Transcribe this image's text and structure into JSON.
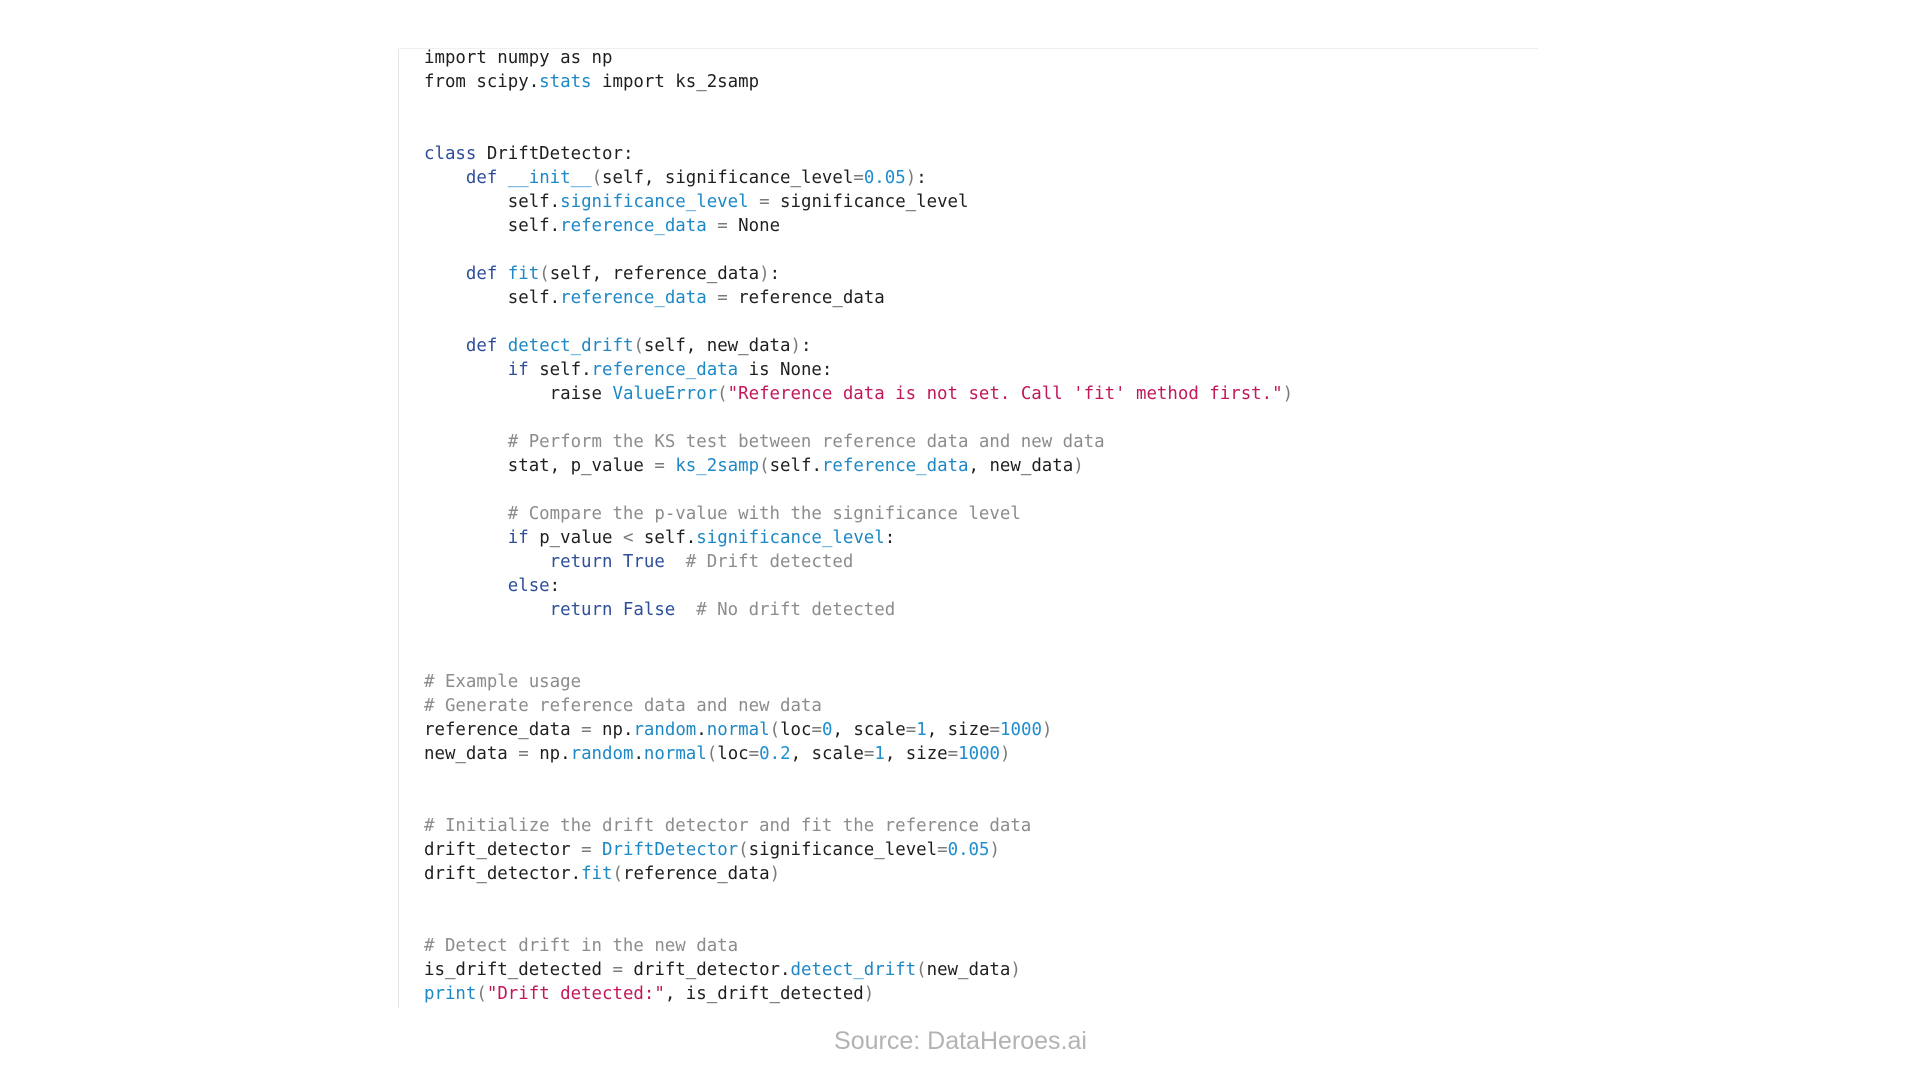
{
  "colors": {
    "keyword": "#2d4f9a",
    "attribute": "#1d88c6",
    "number": "#1f8ecf",
    "string": "#c2185b",
    "comment": "#8c8c8c",
    "punctuation": "#7a7a7a",
    "text": "#1f1f1f",
    "caption": "#b3b3b3"
  },
  "code_lines": [
    [
      [
        "plain",
        "import numpy as np"
      ]
    ],
    [
      [
        "plain",
        "from scipy."
      ],
      [
        "attr",
        "stats"
      ],
      [
        "plain",
        " import ks_2samp"
      ]
    ],
    [],
    [],
    [
      [
        "kw",
        "class"
      ],
      [
        "plain",
        " DriftDetector:"
      ]
    ],
    [
      [
        "plain",
        "    "
      ],
      [
        "kw",
        "def"
      ],
      [
        "plain",
        " "
      ],
      [
        "call",
        "__init__"
      ],
      [
        "punc",
        "("
      ],
      [
        "plain",
        "self, significance_level"
      ],
      [
        "punc",
        "="
      ],
      [
        "num",
        "0.05"
      ],
      [
        "punc",
        ")"
      ],
      [
        "plain",
        ":"
      ]
    ],
    [
      [
        "plain",
        "        self."
      ],
      [
        "attr",
        "significance_level"
      ],
      [
        "plain",
        " "
      ],
      [
        "punc",
        "="
      ],
      [
        "plain",
        " significance_level"
      ]
    ],
    [
      [
        "plain",
        "        self."
      ],
      [
        "attr",
        "reference_data"
      ],
      [
        "plain",
        " "
      ],
      [
        "punc",
        "="
      ],
      [
        "plain",
        " None"
      ]
    ],
    [],
    [
      [
        "plain",
        "    "
      ],
      [
        "kw",
        "def"
      ],
      [
        "plain",
        " "
      ],
      [
        "call",
        "fit"
      ],
      [
        "punc",
        "("
      ],
      [
        "plain",
        "self, reference_data"
      ],
      [
        "punc",
        ")"
      ],
      [
        "plain",
        ":"
      ]
    ],
    [
      [
        "plain",
        "        self."
      ],
      [
        "attr",
        "reference_data"
      ],
      [
        "plain",
        " "
      ],
      [
        "punc",
        "="
      ],
      [
        "plain",
        " reference_data"
      ]
    ],
    [],
    [
      [
        "plain",
        "    "
      ],
      [
        "kw",
        "def"
      ],
      [
        "plain",
        " "
      ],
      [
        "call",
        "detect_drift"
      ],
      [
        "punc",
        "("
      ],
      [
        "plain",
        "self, new_data"
      ],
      [
        "punc",
        ")"
      ],
      [
        "plain",
        ":"
      ]
    ],
    [
      [
        "plain",
        "        "
      ],
      [
        "kw",
        "if"
      ],
      [
        "plain",
        " self."
      ],
      [
        "attr",
        "reference_data"
      ],
      [
        "plain",
        " is None:"
      ]
    ],
    [
      [
        "plain",
        "            raise "
      ],
      [
        "call",
        "ValueError"
      ],
      [
        "punc",
        "("
      ],
      [
        "str",
        "\"Reference data is not set. Call 'fit' method first.\""
      ],
      [
        "punc",
        ")"
      ]
    ],
    [],
    [
      [
        "plain",
        "        "
      ],
      [
        "com",
        "# Perform the KS test between reference data and new data"
      ]
    ],
    [
      [
        "plain",
        "        stat, p_value "
      ],
      [
        "punc",
        "="
      ],
      [
        "plain",
        " "
      ],
      [
        "call",
        "ks_2samp"
      ],
      [
        "punc",
        "("
      ],
      [
        "plain",
        "self."
      ],
      [
        "attr",
        "reference_data"
      ],
      [
        "plain",
        ", new_data"
      ],
      [
        "punc",
        ")"
      ]
    ],
    [],
    [
      [
        "plain",
        "        "
      ],
      [
        "com",
        "# Compare the p-value with the significance level"
      ]
    ],
    [
      [
        "plain",
        "        "
      ],
      [
        "kw",
        "if"
      ],
      [
        "plain",
        " p_value "
      ],
      [
        "punc",
        "<"
      ],
      [
        "plain",
        " self."
      ],
      [
        "attr",
        "significance_level"
      ],
      [
        "plain",
        ":"
      ]
    ],
    [
      [
        "plain",
        "            "
      ],
      [
        "kw",
        "return True"
      ],
      [
        "plain",
        "  "
      ],
      [
        "com",
        "# Drift detected"
      ]
    ],
    [
      [
        "plain",
        "        "
      ],
      [
        "kw",
        "else"
      ],
      [
        "plain",
        ":"
      ]
    ],
    [
      [
        "plain",
        "            "
      ],
      [
        "kw",
        "return False"
      ],
      [
        "plain",
        "  "
      ],
      [
        "com",
        "# No drift detected"
      ]
    ],
    [],
    [],
    [
      [
        "com",
        "# Example usage"
      ]
    ],
    [
      [
        "com",
        "# Generate reference data and new data"
      ]
    ],
    [
      [
        "plain",
        "reference_data "
      ],
      [
        "punc",
        "="
      ],
      [
        "plain",
        " np."
      ],
      [
        "attr",
        "random"
      ],
      [
        "plain",
        "."
      ],
      [
        "call",
        "normal"
      ],
      [
        "punc",
        "("
      ],
      [
        "plain",
        "loc"
      ],
      [
        "punc",
        "="
      ],
      [
        "num",
        "0"
      ],
      [
        "plain",
        ", scale"
      ],
      [
        "punc",
        "="
      ],
      [
        "num",
        "1"
      ],
      [
        "plain",
        ", size"
      ],
      [
        "punc",
        "="
      ],
      [
        "num",
        "1000"
      ],
      [
        "punc",
        ")"
      ]
    ],
    [
      [
        "plain",
        "new_data "
      ],
      [
        "punc",
        "="
      ],
      [
        "plain",
        " np."
      ],
      [
        "attr",
        "random"
      ],
      [
        "plain",
        "."
      ],
      [
        "call",
        "normal"
      ],
      [
        "punc",
        "("
      ],
      [
        "plain",
        "loc"
      ],
      [
        "punc",
        "="
      ],
      [
        "num",
        "0.2"
      ],
      [
        "plain",
        ", scale"
      ],
      [
        "punc",
        "="
      ],
      [
        "num",
        "1"
      ],
      [
        "plain",
        ", size"
      ],
      [
        "punc",
        "="
      ],
      [
        "num",
        "1000"
      ],
      [
        "punc",
        ")"
      ]
    ],
    [],
    [],
    [
      [
        "com",
        "# Initialize the drift detector and fit the reference data"
      ]
    ],
    [
      [
        "plain",
        "drift_detector "
      ],
      [
        "punc",
        "="
      ],
      [
        "plain",
        " "
      ],
      [
        "call",
        "DriftDetector"
      ],
      [
        "punc",
        "("
      ],
      [
        "plain",
        "significance_level"
      ],
      [
        "punc",
        "="
      ],
      [
        "num",
        "0.05"
      ],
      [
        "punc",
        ")"
      ]
    ],
    [
      [
        "plain",
        "drift_detector."
      ],
      [
        "call",
        "fit"
      ],
      [
        "punc",
        "("
      ],
      [
        "plain",
        "reference_data"
      ],
      [
        "punc",
        ")"
      ]
    ],
    [],
    [],
    [
      [
        "com",
        "# Detect drift in the new data"
      ]
    ],
    [
      [
        "plain",
        "is_drift_detected "
      ],
      [
        "punc",
        "="
      ],
      [
        "plain",
        " drift_detector."
      ],
      [
        "call",
        "detect_drift"
      ],
      [
        "punc",
        "("
      ],
      [
        "plain",
        "new_data"
      ],
      [
        "punc",
        ")"
      ]
    ],
    [
      [
        "call",
        "print"
      ],
      [
        "punc",
        "("
      ],
      [
        "str",
        "\"Drift detected:\""
      ],
      [
        "plain",
        ", is_drift_detected"
      ],
      [
        "punc",
        ")"
      ]
    ]
  ],
  "caption": {
    "text": "Source: DataHeroes.ai"
  }
}
